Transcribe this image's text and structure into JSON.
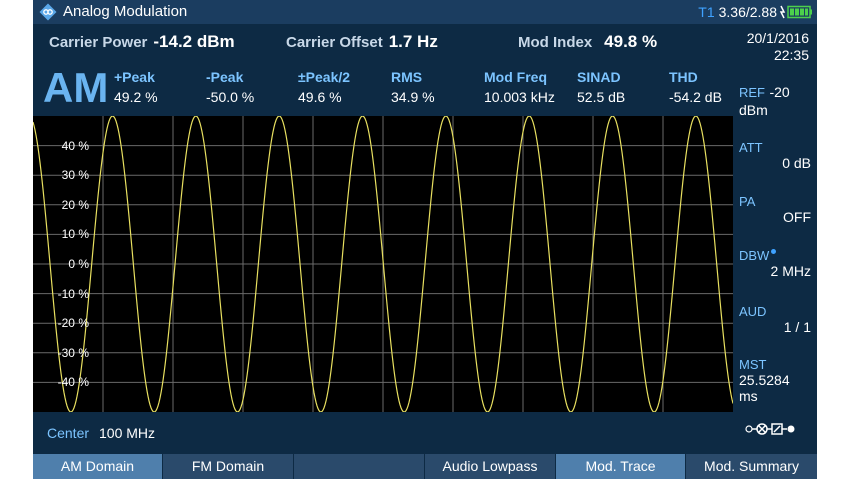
{
  "titlebar": {
    "title": "Analog Modulation",
    "trace_label": "T1",
    "battery_info": "3.36/2.88"
  },
  "header": {
    "carrier_power": {
      "label": "Carrier Power",
      "value": "-14.2 dBm"
    },
    "carrier_offset": {
      "label": "Carrier Offset",
      "value": "1.7 Hz"
    },
    "mod_index": {
      "label": "Mod Index",
      "value": "49.8 %"
    },
    "mode": "AM",
    "measurements": [
      {
        "label": "+Peak",
        "value": "49.2  %"
      },
      {
        "label": "-Peak",
        "value": "-50.0  %"
      },
      {
        "label": "±Peak/2",
        "value": "49.6  %"
      },
      {
        "label": "RMS",
        "value": "34.9  %"
      },
      {
        "label": "Mod Freq",
        "value": "10.003  kHz"
      },
      {
        "label": "SINAD",
        "value": "52.5  dB"
      },
      {
        "label": "THD",
        "value": "-54.2  dB"
      }
    ]
  },
  "right_panel": {
    "date": "20/1/2016",
    "time": "22:35",
    "items": [
      {
        "label": "REF",
        "value": "-20 dBm"
      },
      {
        "label": "ATT",
        "value": "0 dB"
      },
      {
        "label": "PA",
        "value": "OFF"
      },
      {
        "label": "DBW",
        "value": "2 MHz"
      },
      {
        "label": "AUD",
        "value": "1 / 1"
      },
      {
        "label": "MST",
        "value": "25.5284 ms"
      }
    ]
  },
  "plot": {
    "y_ticks": [
      "40 %",
      "30 %",
      "20 %",
      "10 %",
      "0 %",
      "-10 %",
      "-20 %",
      "-30 %",
      "-40 %"
    ],
    "trace_color": "#e8e060",
    "cycles_shown": 8.4
  },
  "center": {
    "label": "Center",
    "value": "100 MHz"
  },
  "softkeys": [
    {
      "label": "AM Domain",
      "active": true
    },
    {
      "label": "FM Domain",
      "active": false
    },
    {
      "label": "",
      "active": false
    },
    {
      "label": "Audio Lowpass",
      "active": false
    },
    {
      "label": "Mod. Trace",
      "active": true
    },
    {
      "label": "Mod. Summary",
      "active": false
    }
  ],
  "colors": {
    "background": "#0d2a44",
    "accent": "#7cc4ff",
    "softkey_active": "#4f7fac"
  }
}
